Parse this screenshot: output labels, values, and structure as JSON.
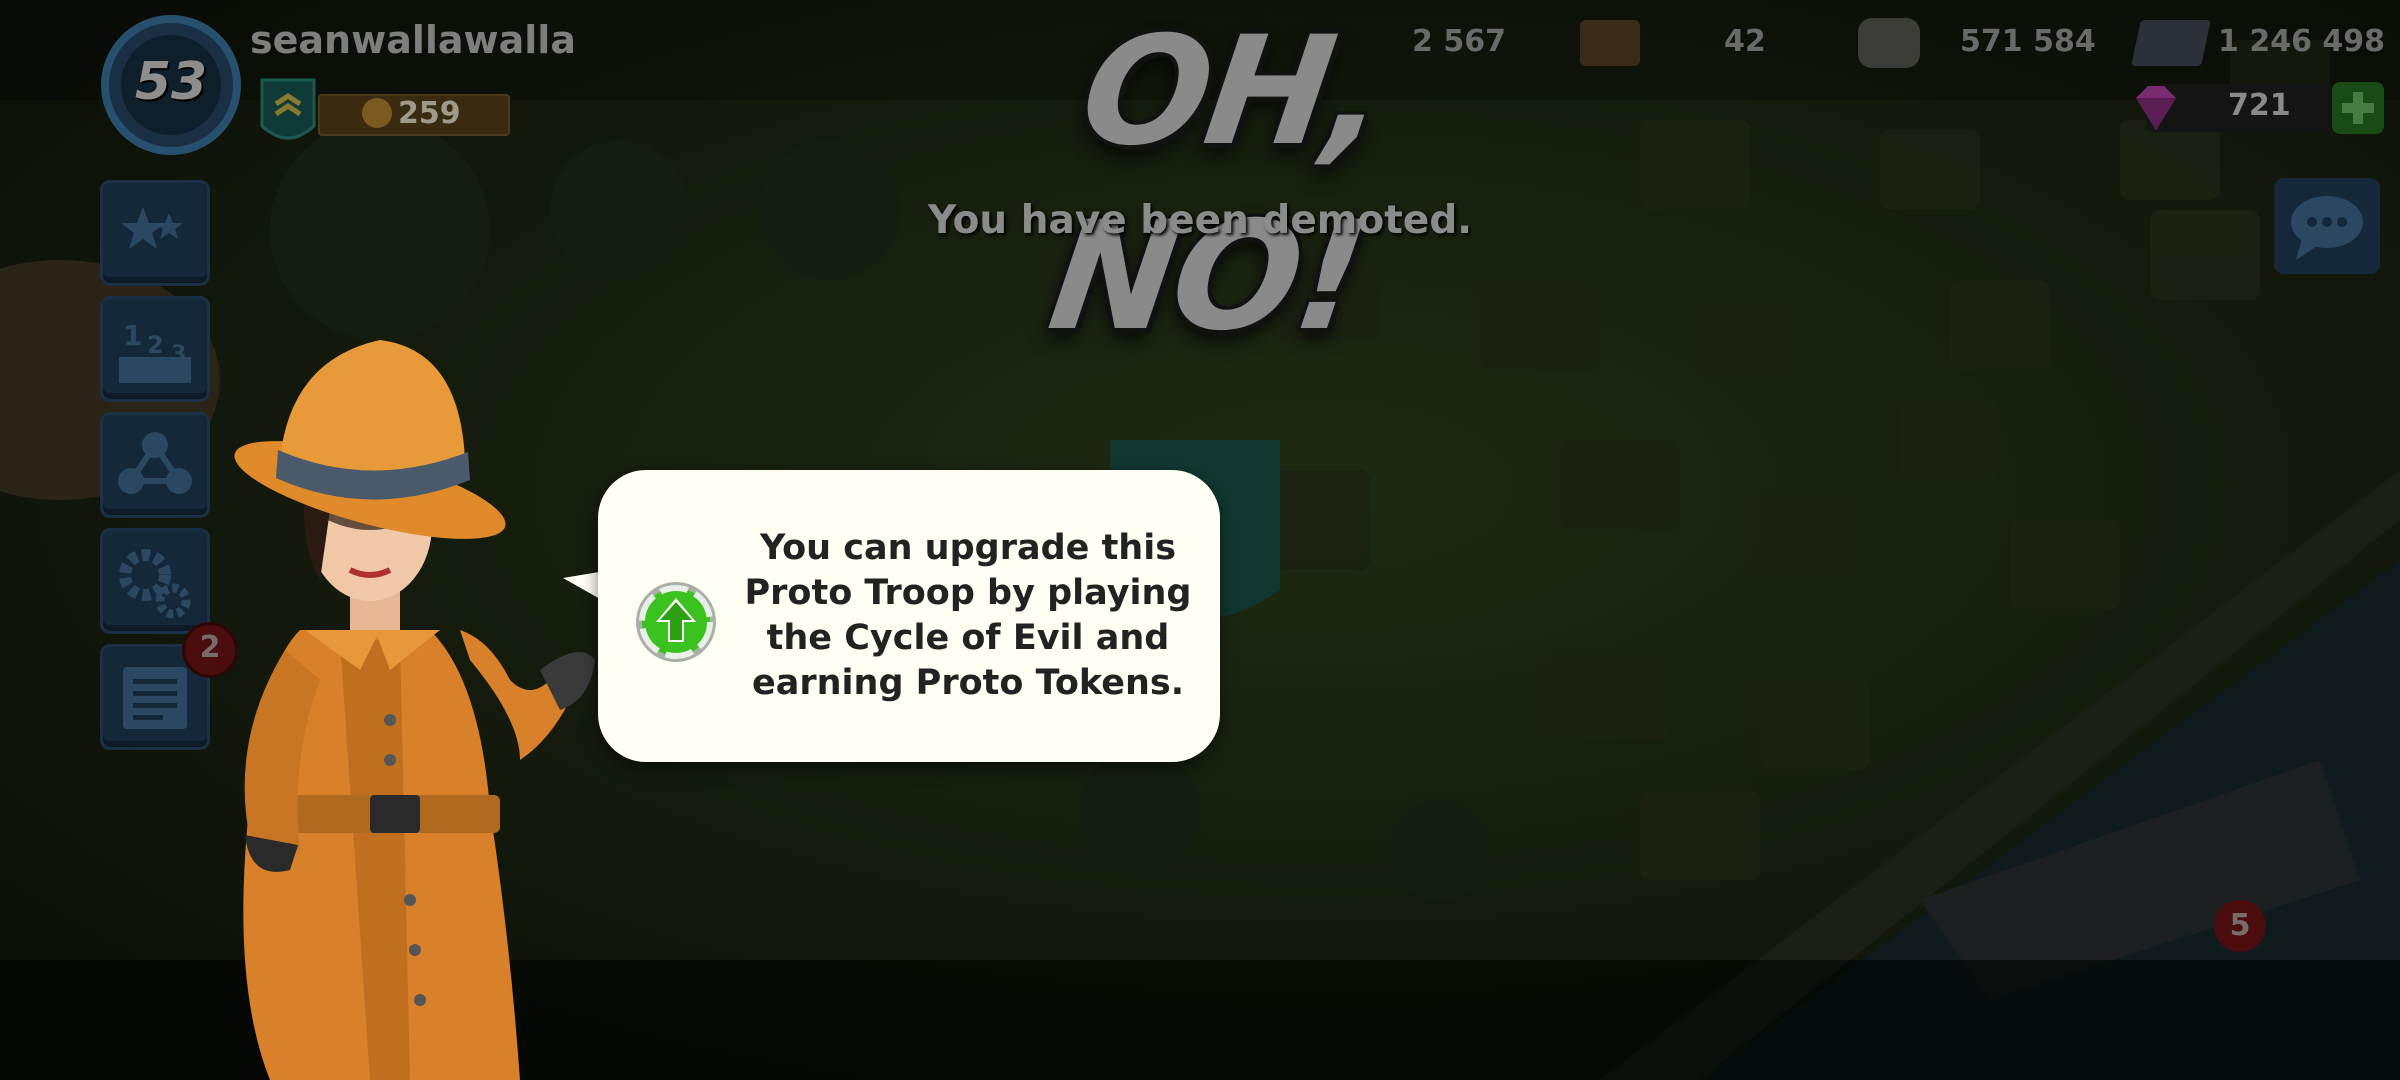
{
  "player": {
    "level": "53",
    "name": "seanwallawalla",
    "victory_points": "259"
  },
  "resources": {
    "gold_partial": "2 567",
    "wood": "42",
    "stone": "571 584",
    "iron": "1 246 498",
    "diamonds": "721"
  },
  "notifications": {
    "reports_badge": "2",
    "bottom_right_badge": "5"
  },
  "dialog": {
    "title": "OH, NO!",
    "subtitle": "You have been demoted.",
    "bubble_text": "You can upgrade this Proto Troop by playing the Cycle of Evil and earning Proto Tokens."
  },
  "colors": {
    "bubble_bg": "#fffff4",
    "coat": "#e08a2c",
    "upgrade_green": "#3cc21e",
    "diamond": "#b03aa8",
    "add_button": "#2fa82a"
  },
  "icons": {
    "side_buttons": [
      "star-icon",
      "leaderboard-icon",
      "task-force-icon",
      "settings-icon",
      "reports-icon"
    ],
    "chat": "chat-icon",
    "upgrade": "upgrade-arrow-icon"
  }
}
